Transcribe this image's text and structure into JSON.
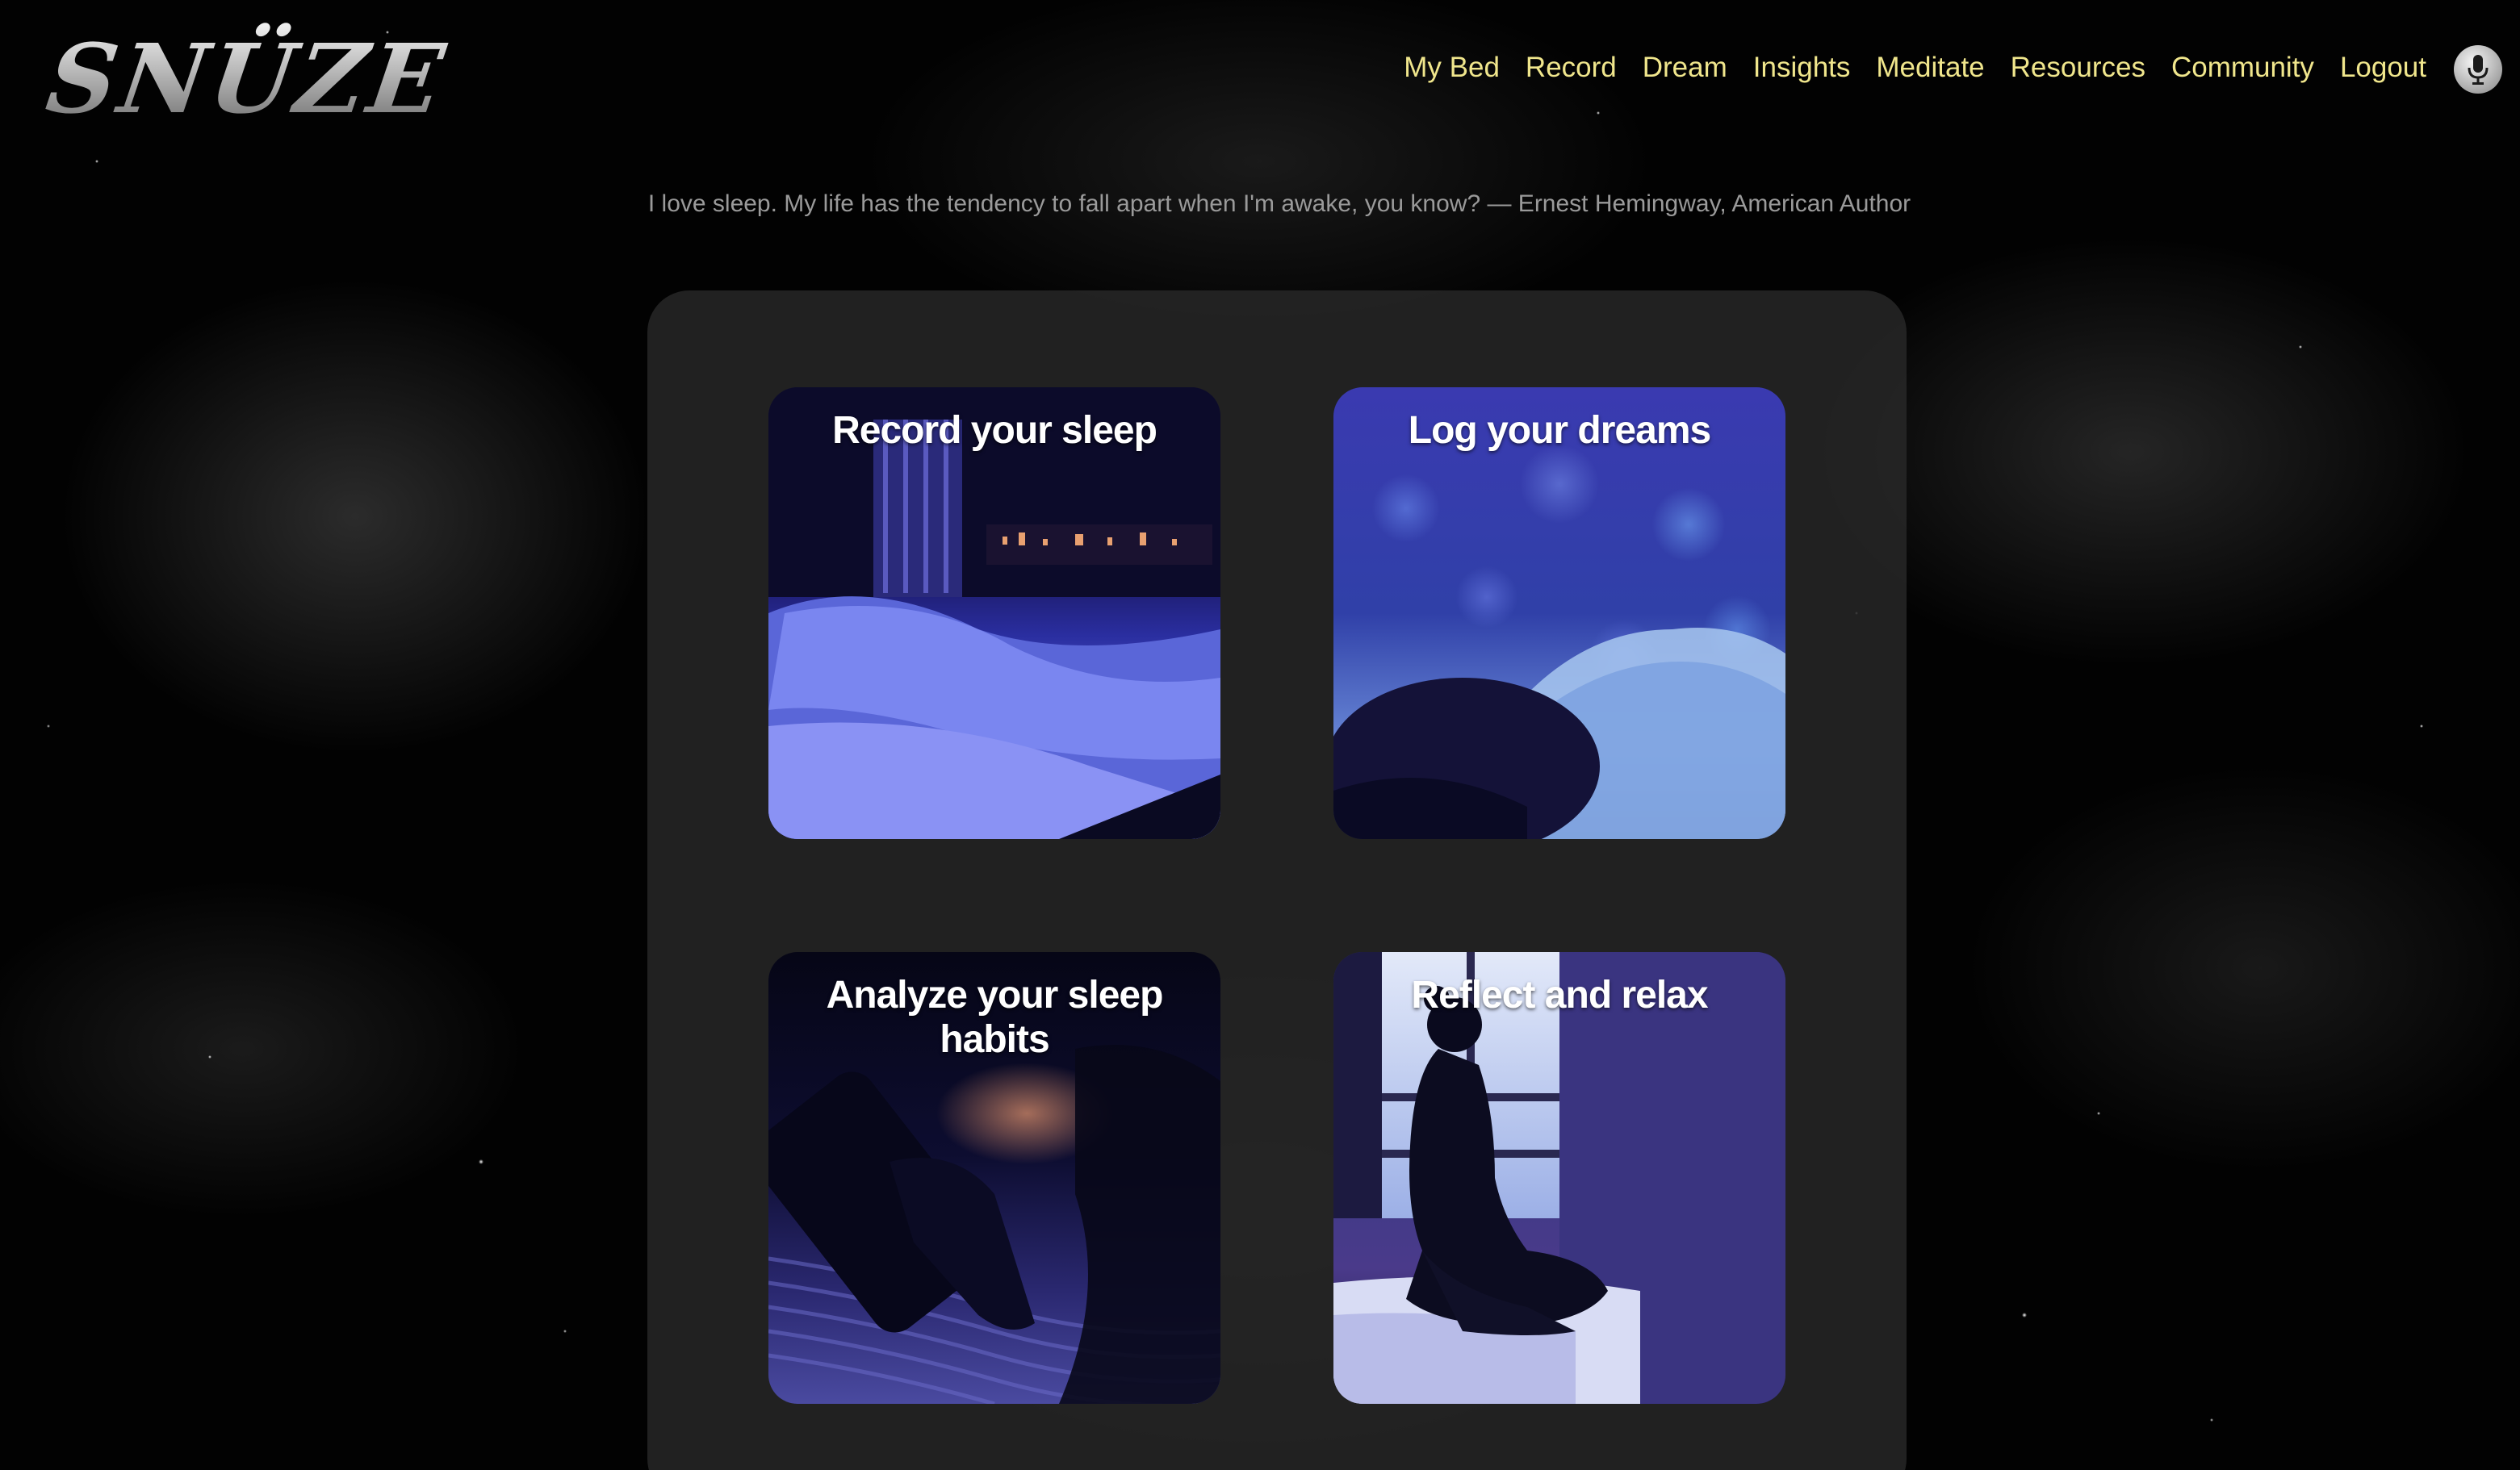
{
  "header": {
    "logo_text": "SNÜZE"
  },
  "nav": {
    "items": [
      {
        "label": "My Bed"
      },
      {
        "label": "Record"
      },
      {
        "label": "Dream"
      },
      {
        "label": "Insights"
      },
      {
        "label": "Meditate"
      },
      {
        "label": "Resources"
      },
      {
        "label": "Community"
      },
      {
        "label": "Logout"
      }
    ],
    "mic_icon": "microphone-icon",
    "link_color": "#f0e68c"
  },
  "quote": {
    "text": "I love sleep. My life has the tendency to fall apart when I'm awake, you know? — Ernest Hemingway, American Author"
  },
  "cards": [
    {
      "title": "Record your sleep"
    },
    {
      "title": "Log your dreams"
    },
    {
      "title": "Analyze your sleep habits"
    },
    {
      "title": "Reflect and relax"
    }
  ]
}
